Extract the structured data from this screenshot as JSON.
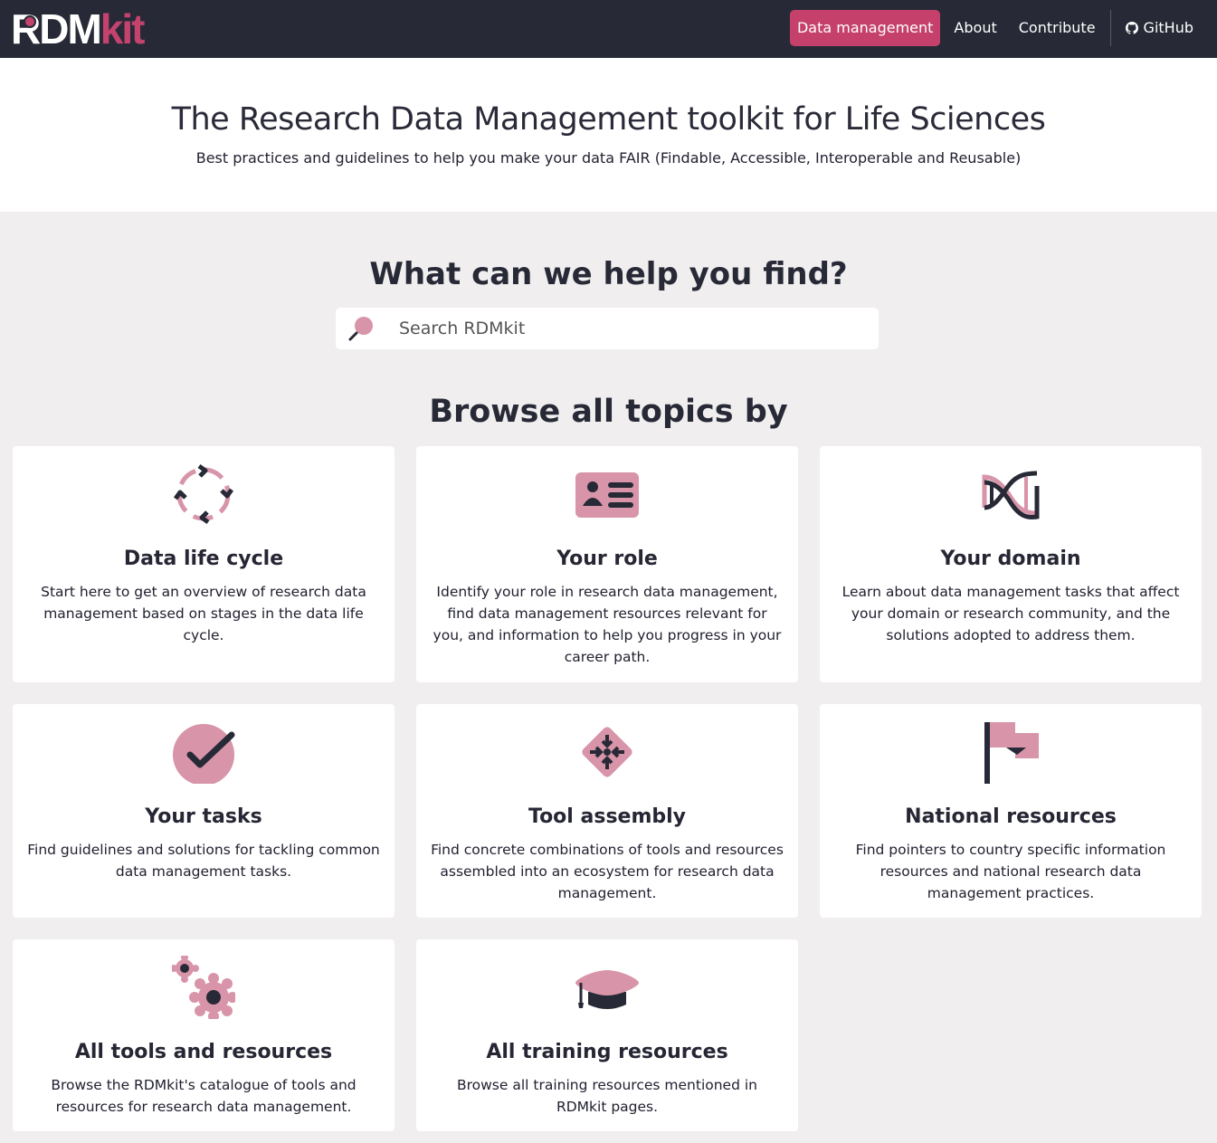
{
  "navbar": {
    "logo_main": "RDM",
    "logo_accent": "kit",
    "links": [
      "Data management",
      "About",
      "Contribute",
      "GitHub"
    ]
  },
  "hero": {
    "title": "The Research Data Management toolkit for Life Sciences",
    "subtitle": "Best practices and guidelines to help you make your data FAIR (Findable, Accessible, Interoperable and Reusable)"
  },
  "search": {
    "heading": "What can we help you find?",
    "placeholder": "Search RDMkit"
  },
  "browse": {
    "heading": "Browse all topics by",
    "cards": [
      {
        "title": "Data life cycle",
        "icon": "cycle-icon",
        "description": "Start here to get an overview of research data management based on stages in the data life cycle."
      },
      {
        "title": "Your role",
        "icon": "id-card-icon",
        "description": "Identify your role in research data management, find data management resources relevant for you, and information to help you progress in your career path."
      },
      {
        "title": "Your domain",
        "icon": "dna-icon",
        "description": "Learn about data management tasks that affect your domain or research community, and the solutions adopted to address them."
      },
      {
        "title": "Your tasks",
        "icon": "check-circle-icon",
        "description": "Find guidelines and solutions for tackling common data management tasks."
      },
      {
        "title": "Tool assembly",
        "icon": "assembly-icon",
        "description": "Find concrete combinations of tools and resources assembled into an ecosystem for research data management."
      },
      {
        "title": "National resources",
        "icon": "flag-icon",
        "description": "Find pointers to country specific information resources and national research data management practices."
      },
      {
        "title": "All tools and resources",
        "icon": "gears-icon",
        "description": "Browse the RDMkit's catalogue of tools and resources for research data management."
      },
      {
        "title": "All training resources",
        "icon": "graduation-cap-icon",
        "description": "Browse all training resources mentioned in RDMkit pages."
      }
    ]
  },
  "colors": {
    "navbar": "#272a36",
    "accent": "#c5416b",
    "icon_pink": "#d894a8",
    "background": "#f0eeef"
  }
}
